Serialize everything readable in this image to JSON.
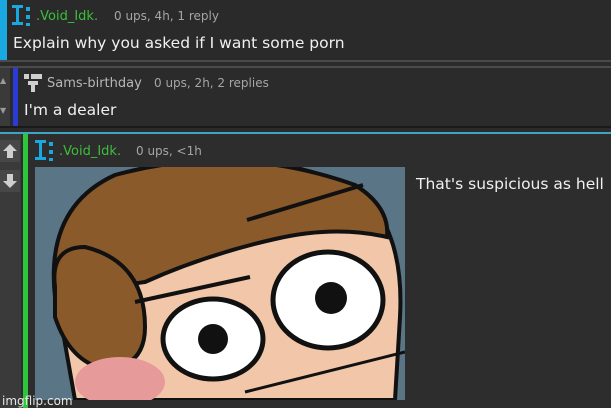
{
  "comments": [
    {
      "username": ".Void_Idk.",
      "meta": "0 ups, 4h, 1 reply",
      "text": "Explain why you asked if I want some porn",
      "accent_color": "#19a9e0",
      "username_color": "#3bbf3b"
    },
    {
      "username": "Sams-birthday",
      "meta": "0 ups, 2h, 2 replies",
      "text": "I'm a dealer",
      "accent_color": "#2a3bd8",
      "username_color": "#b7b7b7"
    },
    {
      "username": ".Void_Idk.",
      "meta": "0 ups, <1h",
      "text": "That's suspicious as hell",
      "accent_color": "#2ec53b",
      "username_color": "#3bbf3b"
    }
  ],
  "watermark": "imgflip.com",
  "icons": {
    "upvote": "arrow-up-icon",
    "downvote": "arrow-down-icon",
    "small_up": "caret-up-icon",
    "small_down": "caret-down-icon"
  }
}
